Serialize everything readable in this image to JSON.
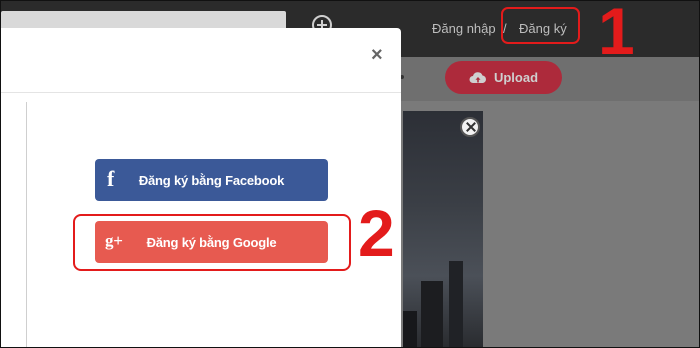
{
  "header": {
    "login_label": "Đăng nhập",
    "separator": "/",
    "signup_label": "Đăng ký"
  },
  "toolbar": {
    "upload_label": "Upload"
  },
  "modal": {
    "close_label": "×",
    "facebook_label": "Đăng ký bằng Facebook",
    "google_label": "Đăng ký bằng Google",
    "facebook_icon": "f",
    "google_icon": "g+"
  },
  "annotations": {
    "step1": "1",
    "step2": "2"
  },
  "colors": {
    "facebook": "#3b5998",
    "google": "#e75a50",
    "annotation": "#e31b1b",
    "upload": "#ad2a3b"
  }
}
